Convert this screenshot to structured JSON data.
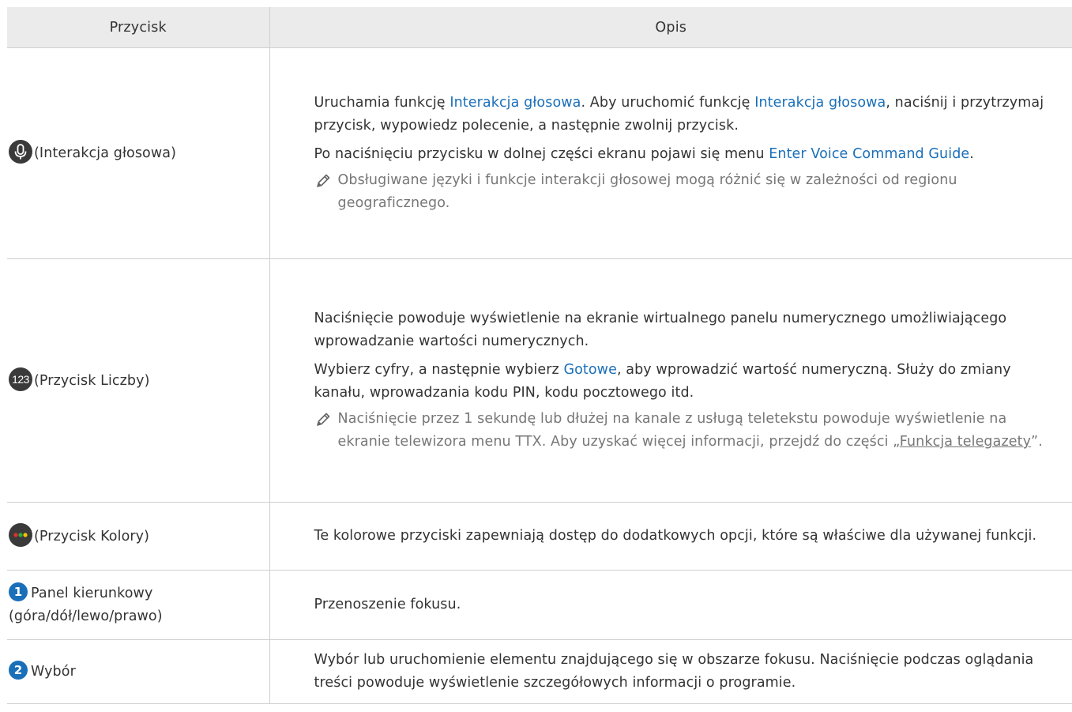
{
  "table": {
    "headers": {
      "button": "Przycisk",
      "description": "Opis"
    },
    "rows": {
      "voice": {
        "button_label": "(Interakcja głosowa)",
        "icon": "microphone-icon",
        "p1_a": "Uruchamia funkcję ",
        "p1_link1": "Interakcja głosowa",
        "p1_b": ". Aby uruchomić funkcję ",
        "p1_link2": "Interakcja głosowa",
        "p1_c": ", naciśnij i przytrzymaj przycisk, wypowiedz polecenie, a następnie zwolnij przycisk.",
        "p2_a": "Po naciśnięciu przycisku w dolnej części ekranu pojawi się menu ",
        "p2_link": "Enter Voice Command Guide",
        "p2_b": ".",
        "note": "Obsługiwane języki i funkcje interakcji głosowej mogą różnić się w zależności od regionu geograficznego."
      },
      "numbers": {
        "button_label": "(Przycisk Liczby)",
        "icon_text": "123",
        "p1": "Naciśnięcie powoduje wyświetlenie na ekranie wirtualnego panelu numerycznego umożliwiającego wprowadzanie wartości numerycznych.",
        "p2_a": "Wybierz cyfry, a następnie wybierz ",
        "p2_link": "Gotowe",
        "p2_b": ", aby wprowadzić wartość numeryczną. Służy do zmiany kanału, wprowadzania kodu PIN, kodu pocztowego itd.",
        "note_a": "Naciśnięcie przez 1 sekundę lub dłużej na kanale z usługą teletekstu powoduje wyświetlenie na ekranie telewizora menu TTX. Aby uzyskać więcej informacji, przejdź do części „",
        "note_link": "Funkcja telegazety",
        "note_b": "”."
      },
      "colors": {
        "button_label": "(Przycisk Kolory)",
        "icon": "color-buttons-icon",
        "description": "Te kolorowe przyciski zapewniają dostęp do dodatkowych opcji, które są właściwe dla używanej funkcji."
      },
      "dpad": {
        "marker": "1",
        "button_label": "Panel kierunkowy (góra/dół/lewo/prawo)",
        "description": "Przenoszenie fokusu."
      },
      "select": {
        "marker": "2",
        "button_label": "Wybór",
        "description": "Wybór lub uruchomienie elementu znajdującego się w obszarze fokusu. Naciśnięcie podczas oglądania treści powoduje wyświetlenie szczegółowych informacji o programie."
      }
    }
  },
  "colors": {
    "link": "#1a6fb9",
    "note_text": "#777777",
    "header_bg": "#ebebeb",
    "icon_bg": "#3a3a3a",
    "dot_red": "#e0312f",
    "dot_green": "#2fae3f",
    "dot_yellow": "#f2c500"
  }
}
